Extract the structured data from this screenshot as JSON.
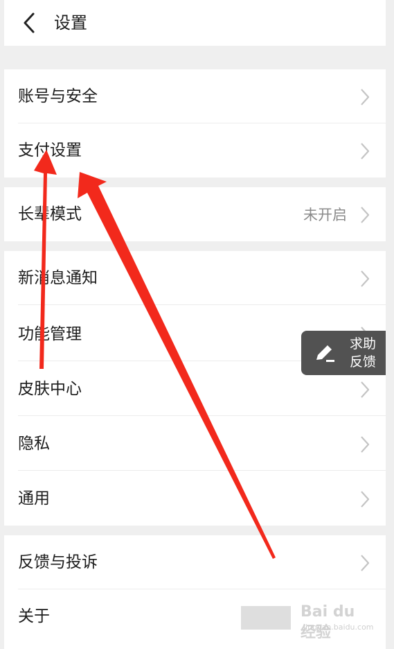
{
  "header": {
    "title": "设置",
    "back_icon": "chevron-left-icon"
  },
  "settings": {
    "groups": [
      {
        "items": [
          {
            "label": "账号与安全"
          },
          {
            "label": "支付设置"
          }
        ]
      },
      {
        "items": [
          {
            "label": "长辈模式",
            "value": "未开启"
          }
        ]
      },
      {
        "items": [
          {
            "label": "新消息通知"
          },
          {
            "label": "功能管理"
          },
          {
            "label": "皮肤中心"
          },
          {
            "label": "隐私"
          },
          {
            "label": "通用"
          }
        ]
      },
      {
        "items": [
          {
            "label": "反馈与投诉"
          },
          {
            "label": "关于"
          }
        ]
      }
    ]
  },
  "help_button": {
    "line1": "求助",
    "line2": "反馈",
    "icon": "edit-pencil-icon"
  },
  "watermark": {
    "text": "Bai du 经验",
    "sub": "jingyan.baidu.com"
  },
  "colors": {
    "arrow": "#f2291c",
    "fab": "#525252",
    "background": "#efefef"
  }
}
